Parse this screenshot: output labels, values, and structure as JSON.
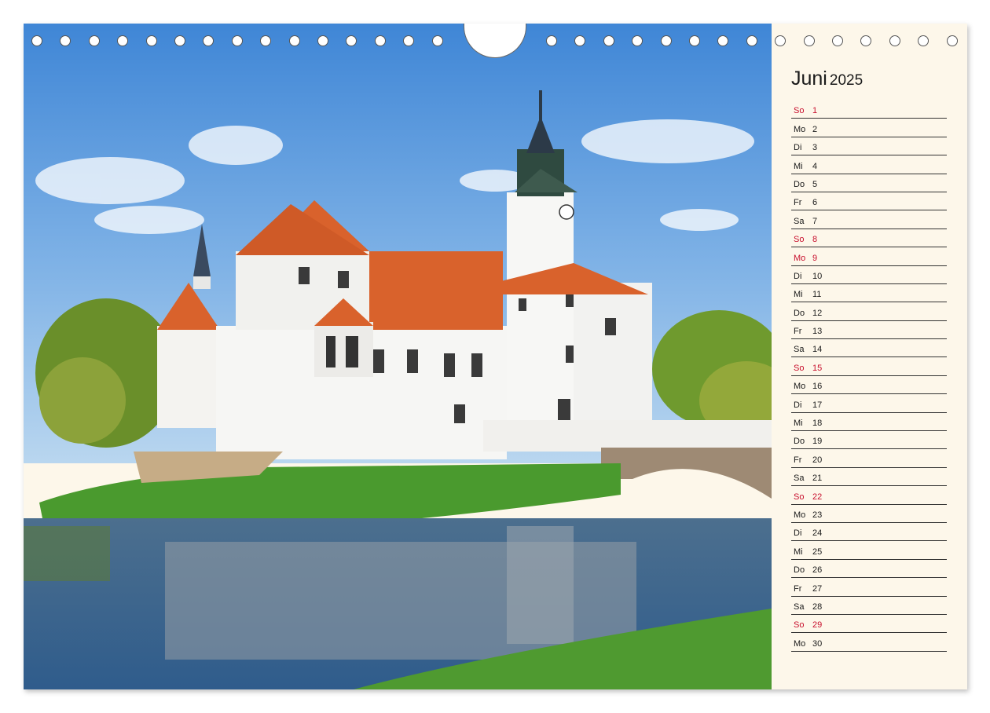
{
  "calendar": {
    "month": "Juni",
    "year": "2025",
    "days": [
      {
        "wd": "So",
        "d": "1",
        "holiday": true
      },
      {
        "wd": "Mo",
        "d": "2",
        "holiday": false
      },
      {
        "wd": "Di",
        "d": "3",
        "holiday": false
      },
      {
        "wd": "Mi",
        "d": "4",
        "holiday": false
      },
      {
        "wd": "Do",
        "d": "5",
        "holiday": false
      },
      {
        "wd": "Fr",
        "d": "6",
        "holiday": false
      },
      {
        "wd": "Sa",
        "d": "7",
        "holiday": false
      },
      {
        "wd": "So",
        "d": "8",
        "holiday": true
      },
      {
        "wd": "Mo",
        "d": "9",
        "holiday": true
      },
      {
        "wd": "Di",
        "d": "10",
        "holiday": false
      },
      {
        "wd": "Mi",
        "d": "11",
        "holiday": false
      },
      {
        "wd": "Do",
        "d": "12",
        "holiday": false
      },
      {
        "wd": "Fr",
        "d": "13",
        "holiday": false
      },
      {
        "wd": "Sa",
        "d": "14",
        "holiday": false
      },
      {
        "wd": "So",
        "d": "15",
        "holiday": true
      },
      {
        "wd": "Mo",
        "d": "16",
        "holiday": false
      },
      {
        "wd": "Di",
        "d": "17",
        "holiday": false
      },
      {
        "wd": "Mi",
        "d": "18",
        "holiday": false
      },
      {
        "wd": "Do",
        "d": "19",
        "holiday": false
      },
      {
        "wd": "Fr",
        "d": "20",
        "holiday": false
      },
      {
        "wd": "Sa",
        "d": "21",
        "holiday": false
      },
      {
        "wd": "So",
        "d": "22",
        "holiday": true
      },
      {
        "wd": "Mo",
        "d": "23",
        "holiday": false
      },
      {
        "wd": "Di",
        "d": "24",
        "holiday": false
      },
      {
        "wd": "Mi",
        "d": "25",
        "holiday": false
      },
      {
        "wd": "Do",
        "d": "26",
        "holiday": false
      },
      {
        "wd": "Fr",
        "d": "27",
        "holiday": false
      },
      {
        "wd": "Sa",
        "d": "28",
        "holiday": false
      },
      {
        "wd": "So",
        "d": "29",
        "holiday": true
      },
      {
        "wd": "Mo",
        "d": "30",
        "holiday": false
      }
    ]
  },
  "colors": {
    "holiday": "#c8102e",
    "text": "#1a1a1a",
    "panel": "#fdf7ea"
  }
}
